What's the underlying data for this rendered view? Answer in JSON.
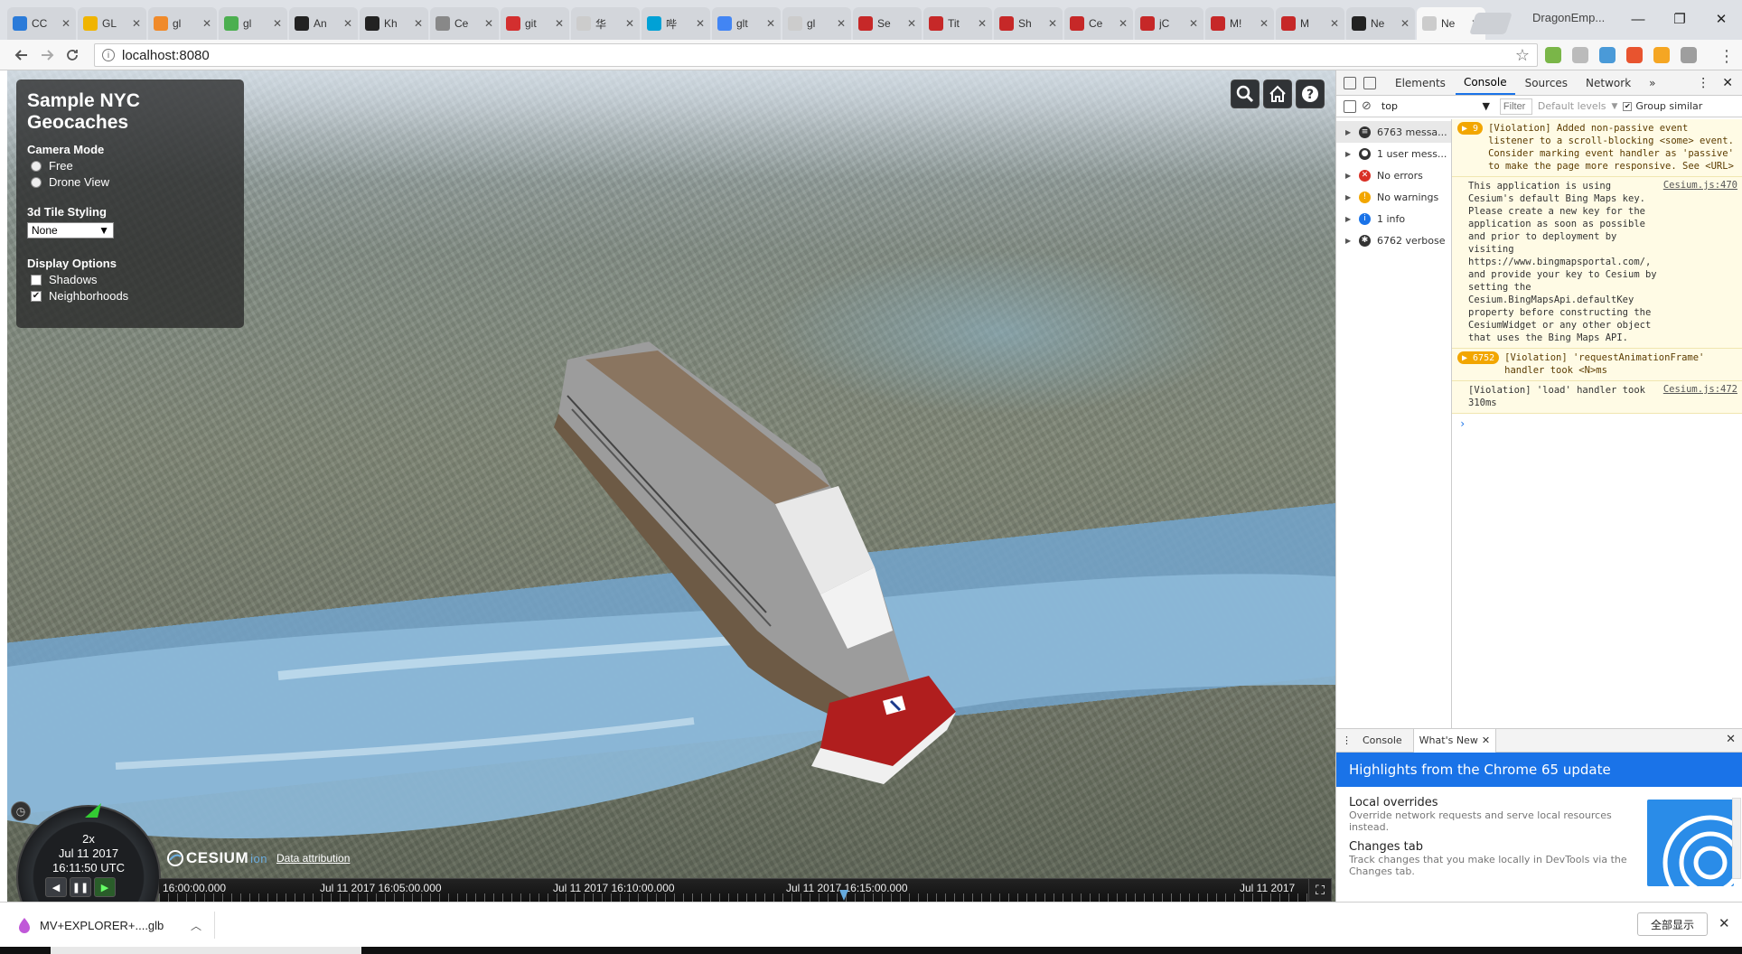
{
  "browser": {
    "tabs": [
      {
        "title": "CC",
        "color": "#2b7bd9"
      },
      {
        "title": "GL",
        "color": "#f0b400"
      },
      {
        "title": "gl",
        "color": "#f08a2a"
      },
      {
        "title": "gl",
        "color": "#4caf50"
      },
      {
        "title": "An",
        "color": "#222222"
      },
      {
        "title": "Kh",
        "color": "#222222"
      },
      {
        "title": "Ce",
        "color": "#888888"
      },
      {
        "title": "git",
        "color": "#d32f2f"
      },
      {
        "title": "华",
        "color": "#cccccc"
      },
      {
        "title": "哔",
        "color": "#00a1d6"
      },
      {
        "title": "glt",
        "color": "#4285f4"
      },
      {
        "title": "gl",
        "color": "#cccccc"
      },
      {
        "title": "Se",
        "color": "#c62828"
      },
      {
        "title": "Tit",
        "color": "#c62828"
      },
      {
        "title": "Sh",
        "color": "#c62828"
      },
      {
        "title": "Ce",
        "color": "#c62828"
      },
      {
        "title": "jC",
        "color": "#c62828"
      },
      {
        "title": "M!",
        "color": "#c62828"
      },
      {
        "title": "M",
        "color": "#c62828"
      },
      {
        "title": "Ne",
        "color": "#222222"
      },
      {
        "title": "Ne",
        "color": "#cccccc",
        "active": true
      }
    ],
    "profile_name": "DragonEmp...",
    "window_buttons": {
      "minimize": "—",
      "restore": "❐",
      "close": "✕"
    },
    "url": "localhost:8080",
    "extension_colors": [
      "#7ab648",
      "#bbbbbb",
      "#4a9ad8",
      "#e8542f",
      "#f5a623",
      "#9e9e9e"
    ]
  },
  "geocache_panel": {
    "title": "Sample NYC Geocaches",
    "camera_mode_label": "Camera Mode",
    "camera_modes": [
      {
        "label": "Free",
        "selected": false
      },
      {
        "label": "Drone View",
        "selected": false
      }
    ],
    "tile_styling_label": "3d Tile Styling",
    "tile_styling_value": "None",
    "display_options_label": "Display Options",
    "display_options": [
      {
        "label": "Shadows",
        "checked": false
      },
      {
        "label": "Neighborhoods",
        "checked": true
      }
    ]
  },
  "cesium": {
    "animation": {
      "speed": "2x",
      "date": "Jul 11 2017",
      "time": "16:11:50 UTC"
    },
    "logo_text": "CESIUM",
    "logo_suffix": "ion",
    "attribution": "Data attribution",
    "timeline_labels": [
      "16:00:00.000",
      "Jul 11 2017 16:05:00.000",
      "Jul 11 2017 16:10:00.000",
      "Jul 11 2017 16:15:00.000",
      "Jul 11 2017"
    ]
  },
  "devtools": {
    "tabs": [
      "Elements",
      "Console",
      "Sources",
      "Network"
    ],
    "active_tab": "Console",
    "more_tabs": "»",
    "context": "top",
    "filter_placeholder": "Filter",
    "levels": "Default levels",
    "group_similar": "Group similar",
    "sidebar": [
      {
        "label": "6763 messa...",
        "icon": "list-icon"
      },
      {
        "label": "1 user mess...",
        "icon": "user-icon"
      },
      {
        "label": "No errors",
        "icon": "error-icon"
      },
      {
        "label": "No warnings",
        "icon": "warning-icon"
      },
      {
        "label": "1 info",
        "icon": "info-icon"
      },
      {
        "label": "6762 verbose",
        "icon": "bug-icon"
      }
    ],
    "messages": [
      {
        "badge": "▶ 9",
        "text": "[Violation] Added non-passive event listener to a scroll-blocking <some> event. Consider marking event handler as 'passive' to make the page more responsive. See <URL>",
        "source": "",
        "type": "warn"
      },
      {
        "badge": "",
        "text": "This application is using Cesium's default Bing Maps key. Please create a new key for the application as soon as possible and prior to deployment by visiting https://www.bingmapsportal.com/, and provide your key to Cesium by setting the Cesium.BingMapsApi.defaultKey property before constructing the CesiumWidget or any other object that uses the Bing Maps API.",
        "source": "Cesium.js:470",
        "type": "plain"
      },
      {
        "badge": "▶ 6752",
        "text": "[Violation] 'requestAnimationFrame' handler took <N>ms",
        "source": "",
        "type": "warn"
      },
      {
        "badge": "",
        "text": "[Violation] 'load' handler took 310ms",
        "source": "Cesium.js:472",
        "type": "plain"
      }
    ],
    "drawer": {
      "tabs": [
        "Console",
        "What's New"
      ],
      "banner": "Highlights from the Chrome 65 update",
      "items": [
        {
          "title": "Local overrides",
          "desc": "Override network requests and serve local resources instead."
        },
        {
          "title": "Changes tab",
          "desc": "Track changes that you make locally in DevTools via the Changes tab."
        }
      ]
    }
  },
  "download_shelf": {
    "file": "MV+EXPLORER+....glb",
    "show_all": "全部显示"
  }
}
